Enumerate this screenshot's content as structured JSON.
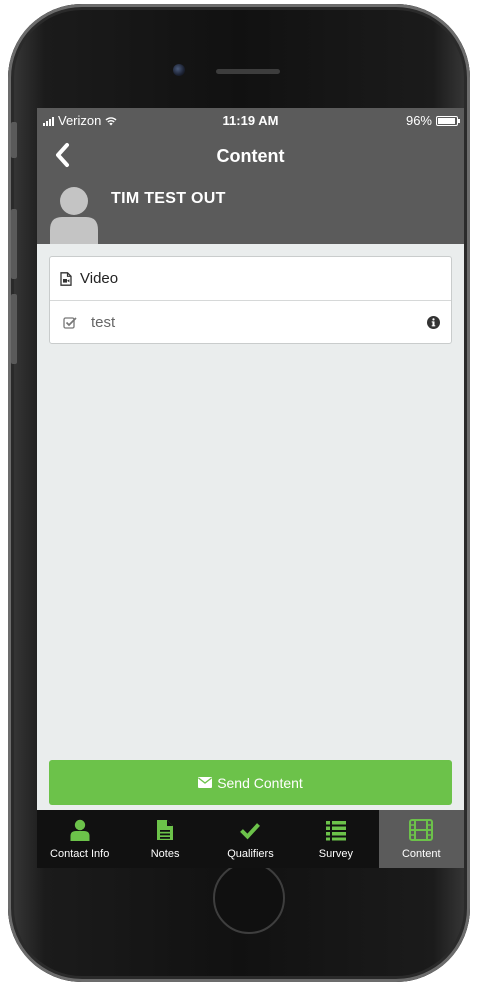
{
  "status_bar": {
    "carrier": "Verizon",
    "time": "11:19 AM",
    "battery": "96%"
  },
  "header": {
    "title": "Content",
    "contact_name": "TIM TEST OUT"
  },
  "content_list": {
    "section_label": "Video",
    "items": [
      {
        "label": "test",
        "checked": true
      }
    ]
  },
  "send_button": {
    "label": "Send Content"
  },
  "tabs": [
    {
      "label": "Contact Info",
      "icon": "person-icon",
      "active": false
    },
    {
      "label": "Notes",
      "icon": "document-icon",
      "active": false
    },
    {
      "label": "Qualifiers",
      "icon": "checkmark-icon",
      "active": false
    },
    {
      "label": "Survey",
      "icon": "list-icon",
      "active": false
    },
    {
      "label": "Content",
      "icon": "film-icon",
      "active": true
    }
  ],
  "colors": {
    "accent_green": "#6cc24a",
    "header_gray": "#5b5b5b",
    "tab_bar_black": "#111111",
    "screen_background": "#eaeded"
  }
}
